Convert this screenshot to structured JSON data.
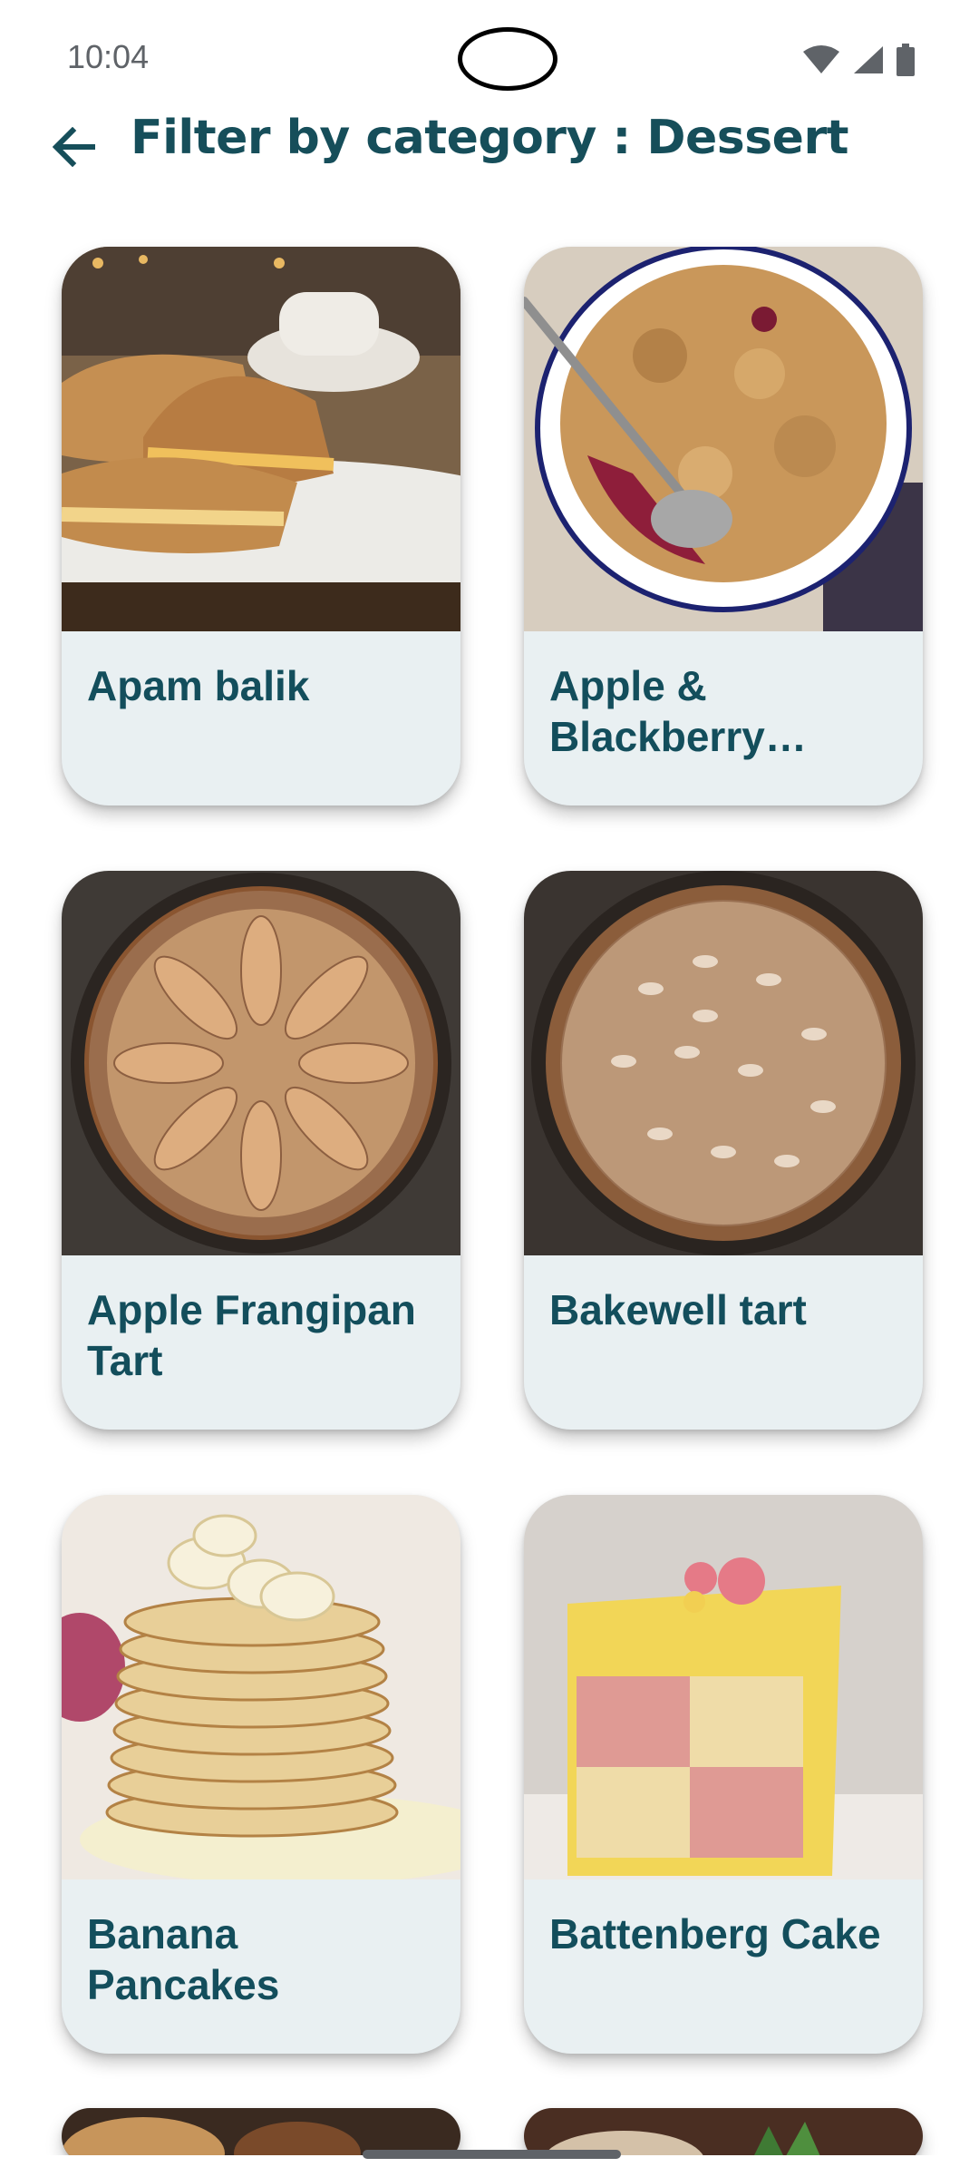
{
  "status_bar": {
    "time": "10:04",
    "icons": [
      "wifi-icon",
      "cellular-signal-icon",
      "battery-icon"
    ]
  },
  "header": {
    "back_icon": "arrow-back-icon",
    "title": "Filter by category : Dessert"
  },
  "colors": {
    "title": "#164e5a",
    "card_background": "#e9f0f2",
    "card_text": "#134e5c"
  },
  "recipes": [
    {
      "name": "Apam balik",
      "image": "apam-balik-photo"
    },
    {
      "name": "Apple & Blackberry Crumble",
      "image": "apple-blackberry-crumble-photo"
    },
    {
      "name": "Apple Frangipan Tart",
      "image": "apple-frangipan-tart-photo"
    },
    {
      "name": "Bakewell tart",
      "image": "bakewell-tart-photo"
    },
    {
      "name": "Banana Pancakes",
      "image": "banana-pancakes-photo"
    },
    {
      "name": "Battenberg Cake",
      "image": "battenberg-cake-photo"
    }
  ]
}
